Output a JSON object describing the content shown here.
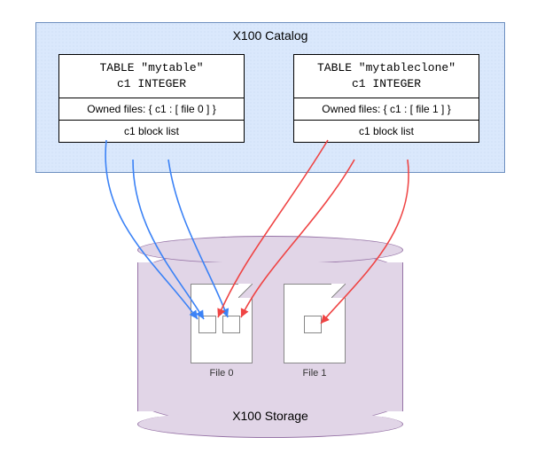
{
  "catalog": {
    "title": "X100 Catalog",
    "tables": [
      {
        "name_line": "TABLE \"mytable\"",
        "col_line": "c1 INTEGER",
        "owned": "Owned files: { c1 : [ file 0 ] }",
        "block_list": "c1 block list"
      },
      {
        "name_line": "TABLE \"mytableclone\"",
        "col_line": "c1 INTEGER",
        "owned": "Owned files: { c1 : [ file 1 ] }",
        "block_list": "c1 block list"
      }
    ]
  },
  "storage": {
    "title": "X100 Storage",
    "files": [
      {
        "label": "File 0",
        "blocks": 2
      },
      {
        "label": "File 1",
        "blocks": 1
      }
    ]
  },
  "colors": {
    "catalog_fill": "#dae8fc",
    "catalog_border": "#6c8ebf",
    "storage_fill": "#e1d5e7",
    "storage_border": "#9673a6",
    "arrow_blue": "#3b82f6",
    "arrow_red": "#ef4444"
  }
}
